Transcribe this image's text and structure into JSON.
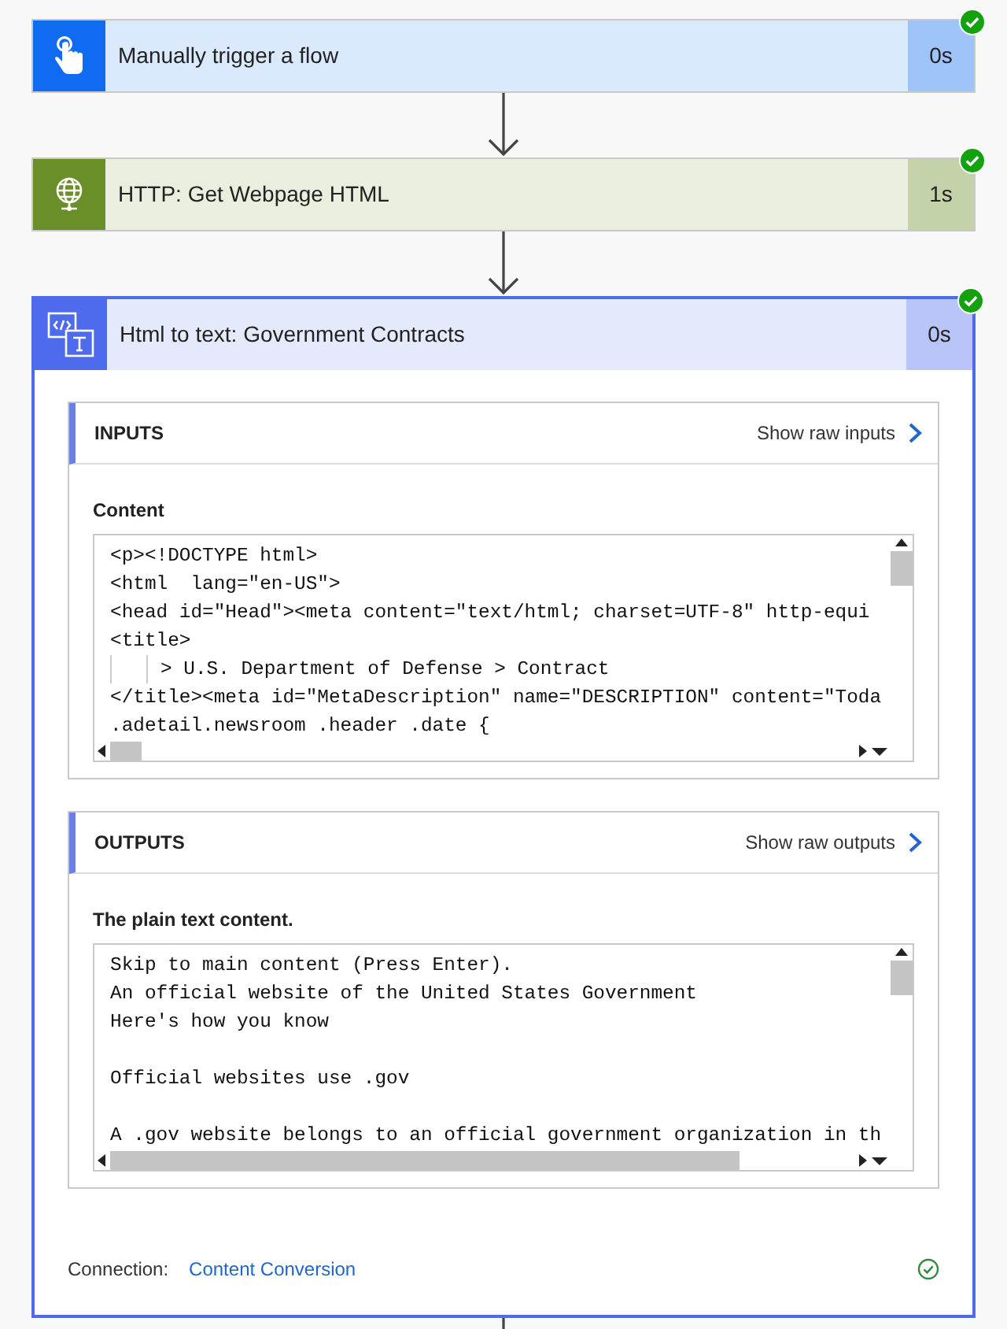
{
  "steps": [
    {
      "kind": "trigger",
      "title": "Manually trigger a flow",
      "duration": "0s",
      "color": "#0f6cf0",
      "succeeded": true,
      "expanded": false
    },
    {
      "kind": "http",
      "title": "HTTP: Get Webpage HTML",
      "duration": "1s",
      "color": "#6a8f28",
      "succeeded": true,
      "expanded": false
    },
    {
      "kind": "convert",
      "title": "Html to text: Government Contracts",
      "duration": "0s",
      "color": "#4f6bed",
      "succeeded": true,
      "expanded": true,
      "sections": [
        {
          "title": "INPUTS",
          "link": "Show raw inputs",
          "field_label": "Content",
          "lines": [
            {
              "kind": "text",
              "text": "<p><!DOCTYPE html>"
            },
            {
              "kind": "text",
              "text": "<html  lang=\"en-US\">"
            },
            {
              "kind": "text",
              "text": "<head id=\"Head\"><meta content=\"text/html; charset=UTF-8\" http-equi"
            },
            {
              "kind": "text",
              "text": "<title>"
            },
            {
              "kind": "indented",
              "text": "> U.S. Department of Defense > Contract"
            },
            {
              "kind": "text",
              "text": "</title><meta id=\"MetaDescription\" name=\"DESCRIPTION\" content=\"Toda"
            },
            {
              "kind": "text",
              "text": ".adetail.newsroom .header .date {"
            }
          ]
        },
        {
          "title": "OUTPUTS",
          "link": "Show raw outputs",
          "field_label": "The plain text content.",
          "lines": [
            {
              "kind": "text",
              "text": "Skip to main content (Press Enter)."
            },
            {
              "kind": "text",
              "text": "An official website of the United States Government"
            },
            {
              "kind": "text",
              "text": "Here's how you know"
            },
            {
              "kind": "blank"
            },
            {
              "kind": "text",
              "text": "Official websites use .gov"
            },
            {
              "kind": "blank"
            },
            {
              "kind": "text",
              "text": "A .gov website belongs to an official government organization in th"
            }
          ]
        }
      ],
      "connection": {
        "label": "Connection:",
        "value": "Content Conversion",
        "ok": true
      }
    }
  ]
}
